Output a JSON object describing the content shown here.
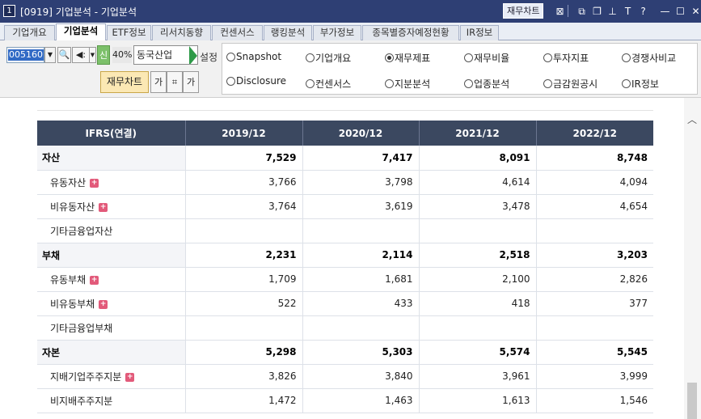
{
  "window": {
    "number": "1",
    "title": "[0919] 기업분석 - 기업분석",
    "chart_button": "재무차트",
    "icons": [
      "line-chart-icon",
      "restore-icon",
      "new-window-icon",
      "pin-icon",
      "font-icon",
      "help-icon",
      "minimize-icon",
      "maximize-icon",
      "close-icon"
    ],
    "icon_glyphs": [
      "⊠",
      "⧉",
      "❐",
      "⊥",
      "T",
      "?",
      "—",
      "☐",
      "✕"
    ],
    "colors": {
      "titlebar": "#2e3f74",
      "header": "#3b4860",
      "accent_plus": "#e25a7a"
    }
  },
  "tabs": [
    {
      "label": "기업개요",
      "active": false
    },
    {
      "label": "기업분석",
      "active": true
    },
    {
      "label": "ETF정보",
      "active": false
    },
    {
      "label": "리서치동향",
      "active": false
    },
    {
      "label": "컨센서스",
      "active": false
    },
    {
      "label": "랭킹분석",
      "active": false
    },
    {
      "label": "부가정보",
      "active": false
    },
    {
      "label": "종목별증자예정현황",
      "active": false
    },
    {
      "label": "IR정보",
      "active": false
    }
  ],
  "controls": {
    "stock_code": "005160",
    "credit_badge": "신",
    "margin_pct": "40%",
    "stock_name": "동국산업",
    "settings_label": "설정",
    "chart_button": "재무차트",
    "small_buttons": [
      "가",
      "⌗",
      "가"
    ]
  },
  "radios": [
    {
      "label": "Snapshot",
      "checked": false
    },
    {
      "label": "기업개요",
      "checked": false
    },
    {
      "label": "재무제표",
      "checked": true
    },
    {
      "label": "재무비율",
      "checked": false
    },
    {
      "label": "투자지표",
      "checked": false
    },
    {
      "label": "경쟁사비교",
      "checked": false
    },
    {
      "label": "Disclosure",
      "checked": false
    },
    {
      "label": "컨센서스",
      "checked": false
    },
    {
      "label": "지분분석",
      "checked": false
    },
    {
      "label": "업종분석",
      "checked": false
    },
    {
      "label": "금감원공시",
      "checked": false
    },
    {
      "label": "IR정보",
      "checked": false
    }
  ],
  "table": {
    "header": [
      "IFRS(연결)",
      "2019/12",
      "2020/12",
      "2021/12",
      "2022/12"
    ],
    "rows": [
      {
        "label": "자산",
        "type": "major",
        "expand": false,
        "values": [
          "7,529",
          "7,417",
          "8,091",
          "8,748"
        ]
      },
      {
        "label": "유동자산",
        "type": "sub",
        "expand": true,
        "values": [
          "3,766",
          "3,798",
          "4,614",
          "4,094"
        ]
      },
      {
        "label": "비유동자산",
        "type": "sub",
        "expand": true,
        "values": [
          "3,764",
          "3,619",
          "3,478",
          "4,654"
        ]
      },
      {
        "label": "기타금융업자산",
        "type": "sub",
        "expand": false,
        "values": [
          "",
          "",
          "",
          ""
        ]
      },
      {
        "label": "부채",
        "type": "major",
        "expand": false,
        "values": [
          "2,231",
          "2,114",
          "2,518",
          "3,203"
        ]
      },
      {
        "label": "유동부채",
        "type": "sub",
        "expand": true,
        "values": [
          "1,709",
          "1,681",
          "2,100",
          "2,826"
        ]
      },
      {
        "label": "비유동부채",
        "type": "sub",
        "expand": true,
        "values": [
          "522",
          "433",
          "418",
          "377"
        ]
      },
      {
        "label": "기타금융업부채",
        "type": "sub",
        "expand": false,
        "values": [
          "",
          "",
          "",
          ""
        ]
      },
      {
        "label": "자본",
        "type": "major",
        "expand": false,
        "values": [
          "5,298",
          "5,303",
          "5,574",
          "5,545"
        ]
      },
      {
        "label": "지배기업주주지분",
        "type": "sub",
        "expand": true,
        "values": [
          "3,826",
          "3,840",
          "3,961",
          "3,999"
        ]
      },
      {
        "label": "비지배주주지분",
        "type": "sub",
        "expand": false,
        "values": [
          "1,472",
          "1,463",
          "1,613",
          "1,546"
        ]
      }
    ]
  }
}
